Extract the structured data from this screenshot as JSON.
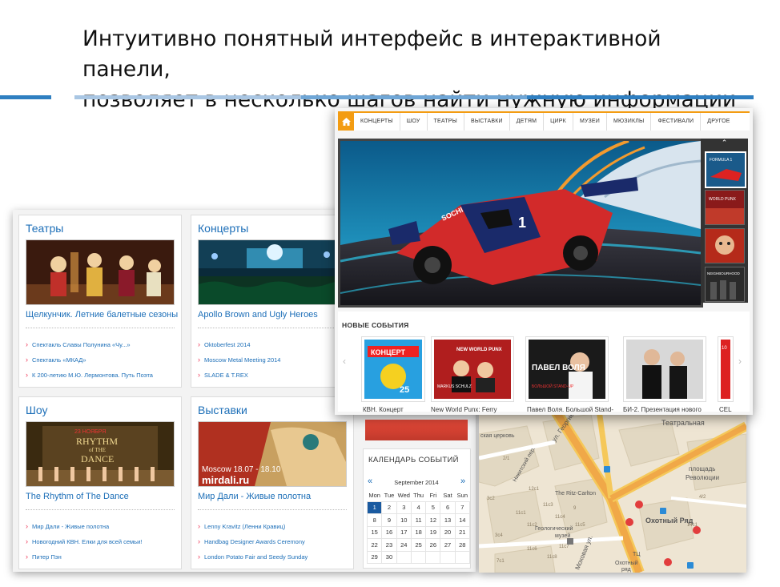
{
  "slide": {
    "title_line1": "Интуитивно понятный интерфейс в интерактивной панели,",
    "title_line2": "позволяет в несколько шагов найти нужную информации"
  },
  "back_panel": {
    "cards": [
      {
        "title": "Театры",
        "headline": "Щелкунчик. Летние балетные сезоны",
        "links": [
          "Спектакль Славы Полунина «Чу...»",
          "Спектакль «МКАД»",
          "К 200-летию М.Ю. Лермонтова. Путь Поэта"
        ]
      },
      {
        "title": "Концерты",
        "headline": "Apollo Brown and Ugly Heroes",
        "links": [
          "Oktoberfest 2014",
          "Moscow Metal Meeting 2014",
          "SLADE & T.REX"
        ]
      },
      {
        "title": "Шоу",
        "headline": "The Rhythm of The Dance",
        "links": [
          "Мир Дали - Живые полотна",
          "Новогодний КВН. Елки для всей семьи!",
          "Питер Пэн"
        ],
        "thumb_text1": "23 НОЯБРЯ",
        "thumb_text2": "RHYTHM",
        "thumb_text3": "of THE",
        "thumb_text4": "DANCE"
      },
      {
        "title": "Выставки",
        "headline": "Мир Дали - Живые полотна",
        "links": [
          "Lenny Kravitz (Ленни Кравиц)",
          "Handbag Designer Awards Ceremony",
          "London Potato Fair and Seedy Sunday"
        ],
        "thumb_text1": "Moscow 18.07 - 18.10",
        "thumb_text2": "mirdali.ru"
      }
    ],
    "calendar": {
      "title": "КАЛЕНДАРЬ СОБЫТИЙ",
      "month": "September 2014",
      "prev": "«",
      "next": "»",
      "weekdays": [
        "Mon",
        "Tue",
        "Wed",
        "Thu",
        "Fri",
        "Sat",
        "Sun"
      ],
      "weeks": [
        [
          "1",
          "2",
          "3",
          "4",
          "5",
          "6",
          "7"
        ],
        [
          "8",
          "9",
          "10",
          "11",
          "12",
          "13",
          "14"
        ],
        [
          "15",
          "16",
          "17",
          "18",
          "19",
          "20",
          "21"
        ],
        [
          "22",
          "23",
          "24",
          "25",
          "26",
          "27",
          "28"
        ],
        [
          "29",
          "30",
          "",
          "",
          "",
          "",
          ""
        ]
      ],
      "today": "1"
    }
  },
  "map": {
    "labels": [
      "Театральная",
      "площадь",
      "Революции",
      "Охотный Ряд",
      "ТЦ",
      "Охотный",
      "ряд",
      "The Ritz-Carlton",
      "Геологический",
      "музей",
      "Моховая ул.",
      "ул. Георгиевский",
      "Никитский пер.",
      "ская церковь"
    ],
    "house_numbers": [
      "3с2",
      "11с1",
      "12с1",
      "9",
      "11с3",
      "11с4",
      "11с6",
      "11с7",
      "11с8",
      "11с5",
      "3с4",
      "7с1",
      "2/1",
      "11с2",
      "14с1",
      "4/2"
    ]
  },
  "front_panel": {
    "nav": [
      "КОНЦЕРТЫ",
      "ШОУ",
      "ТЕАТРЫ",
      "ВЫСТАВКИ",
      "ДЕТЯМ",
      "ЦИРК",
      "МУЗЕИ",
      "МЮЗИКЛЫ",
      "ФЕСТИВАЛИ",
      "ДРУГОЕ"
    ],
    "slider": {
      "car_number": "1",
      "car_brand": "SOCHI",
      "up_arrow": "⌃"
    },
    "side_thumbs": [
      {
        "text": "FORMULA 1"
      },
      {
        "text": "WORLD PUNX"
      },
      {
        "text": ""
      },
      {
        "text": "NEIGHBOURHOOD"
      }
    ],
    "events_title": "НОВЫЕ СОБЫТИЯ",
    "events": [
      {
        "caption": "КВН. Концерт",
        "t1": "КОНЦЕРТ",
        "t2": "25"
      },
      {
        "caption": "New World Punx: Ferry",
        "t1": "NEW WORLD PUNX",
        "t2": "MARKUS SCHULZ"
      },
      {
        "caption": "Павел Воля. Большой Stand-",
        "t1": "ПАВЕЛ ВОЛЯ",
        "t2": "БОЛЬШОЙ STAND-UP"
      },
      {
        "caption": "БИ-2. Презентация нового",
        "t1": "",
        "t2": ""
      },
      {
        "caption": "CEL",
        "t1": "10",
        "t2": ""
      }
    ],
    "arrow_left": "‹",
    "arrow_right": "›"
  }
}
